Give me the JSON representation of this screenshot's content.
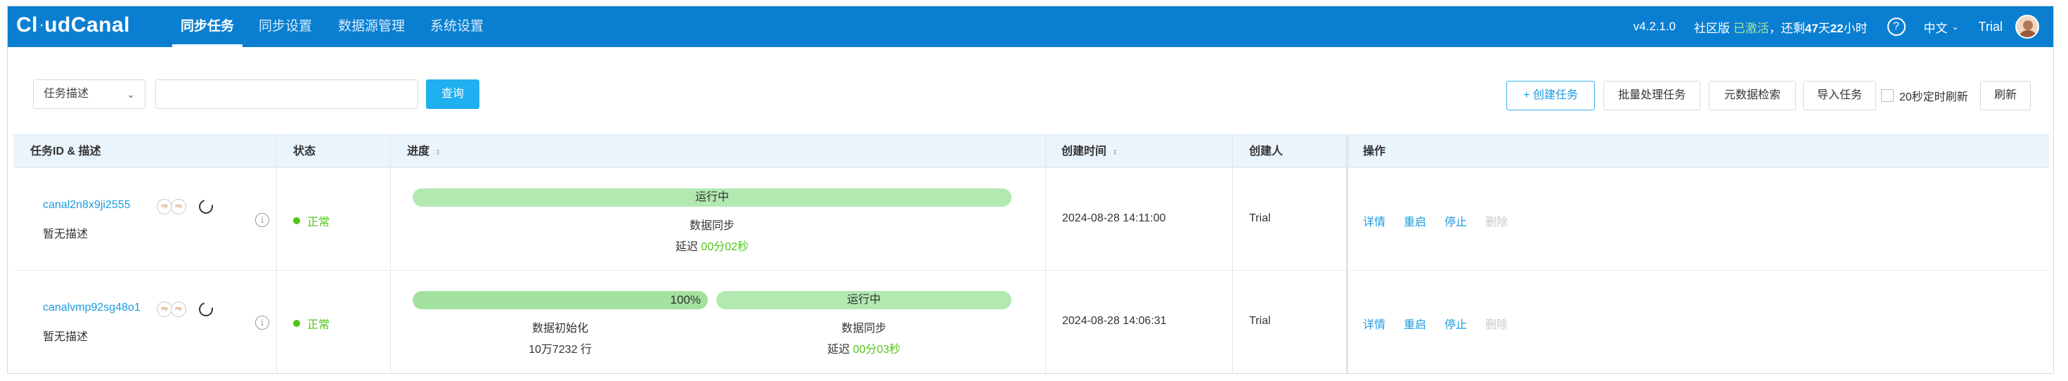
{
  "header": {
    "logo": {
      "left": "Cl",
      "mid": "ud",
      "right": "Canal"
    },
    "nav": [
      "同步任务",
      "同步设置",
      "数据源管理",
      "系统设置"
    ],
    "version": "v4.2.1.0",
    "edition_prefix": "社区版",
    "edition_status": "已激活",
    "remaining_prefix": "，还剩",
    "days": "47",
    "days_unit": "天",
    "hours": "22",
    "hours_unit": "小时",
    "help": "?",
    "language": "中文",
    "user": "Trial"
  },
  "toolbar": {
    "filter_select": "任务描述",
    "search_value": "",
    "query_label": "查询",
    "create_label": "+ 创建任务",
    "batch_label": "批量处理任务",
    "meta_search_label": "元数据检索",
    "import_label": "导入任务",
    "auto_refresh_label": "20秒定时刷新",
    "refresh_label": "刷新"
  },
  "table": {
    "columns": [
      "任务ID & 描述",
      "状态",
      "进度",
      "创建时间",
      "创建人",
      "操作"
    ],
    "rows": [
      {
        "id": "canal2n8x9ji2555",
        "desc": "暂无描述",
        "source_db": "my",
        "target_db": "my",
        "status": "正常",
        "stages": [
          {
            "label": "运行中",
            "name": "数据同步",
            "detail_prefix": "延迟 ",
            "detail_value": "00分02秒",
            "fraction": 1.0
          }
        ],
        "created": "2024-08-28 14:11:00",
        "creator": "Trial",
        "ops": [
          "详情",
          "重启",
          "停止",
          "删除"
        ]
      },
      {
        "id": "canalvmp92sg48o1",
        "desc": "暂无描述",
        "source_db": "my",
        "target_db": "my",
        "status": "正常",
        "stages": [
          {
            "label": "100%",
            "name": "数据初始化",
            "detail_prefix": "",
            "detail_value": "10万7232 行",
            "fraction": 1.0
          },
          {
            "label": "运行中",
            "name": "数据同步",
            "detail_prefix": "延迟 ",
            "detail_value": "00分03秒",
            "fraction": 1.0
          }
        ],
        "created": "2024-08-28 14:06:31",
        "creator": "Trial",
        "ops": [
          "详情",
          "重启",
          "停止",
          "删除"
        ]
      }
    ]
  }
}
